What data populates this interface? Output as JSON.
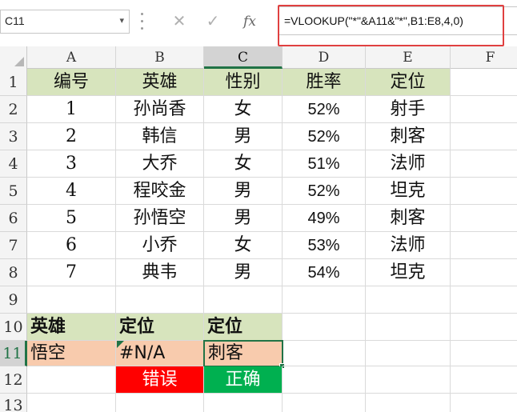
{
  "name_box": {
    "value": "C11",
    "arrow_glyph": "▾"
  },
  "formula_bar": {
    "cancel_glyph": "✕",
    "enter_glyph": "✓",
    "fx_label": "fx",
    "formula": "=VLOOKUP(\"*\"&A11&\"*\",B1:E8,4,0)"
  },
  "columns": [
    "A",
    "B",
    "C",
    "D",
    "E",
    "F"
  ],
  "rows": [
    "1",
    "2",
    "3",
    "4",
    "5",
    "6",
    "7",
    "8",
    "9",
    "10",
    "11",
    "12",
    "13"
  ],
  "selected_column": "C",
  "selected_row": "11",
  "table": {
    "headers": [
      "编号",
      "英雄",
      "性别",
      "胜率",
      "定位"
    ],
    "rows": [
      [
        "1",
        "孙尚香",
        "女",
        "52%",
        "射手"
      ],
      [
        "2",
        "韩信",
        "男",
        "52%",
        "刺客"
      ],
      [
        "3",
        "大乔",
        "女",
        "51%",
        "法师"
      ],
      [
        "4",
        "程咬金",
        "男",
        "52%",
        "坦克"
      ],
      [
        "5",
        "孙悟空",
        "男",
        "49%",
        "刺客"
      ],
      [
        "6",
        "小乔",
        "女",
        "53%",
        "法师"
      ],
      [
        "7",
        "典韦",
        "男",
        "54%",
        "坦克"
      ]
    ]
  },
  "lookup": {
    "headers": [
      "英雄",
      "定位",
      "定位"
    ],
    "values": [
      "悟空",
      "#N/A",
      "刺客"
    ],
    "labels": [
      "错误",
      "正确"
    ]
  },
  "colors": {
    "header_green": "#d7e4bd",
    "peach": "#f8cbad",
    "error_red": "#ff0000",
    "ok_green": "#00b050",
    "selection": "#217346",
    "highlight_box": "#e04040"
  }
}
